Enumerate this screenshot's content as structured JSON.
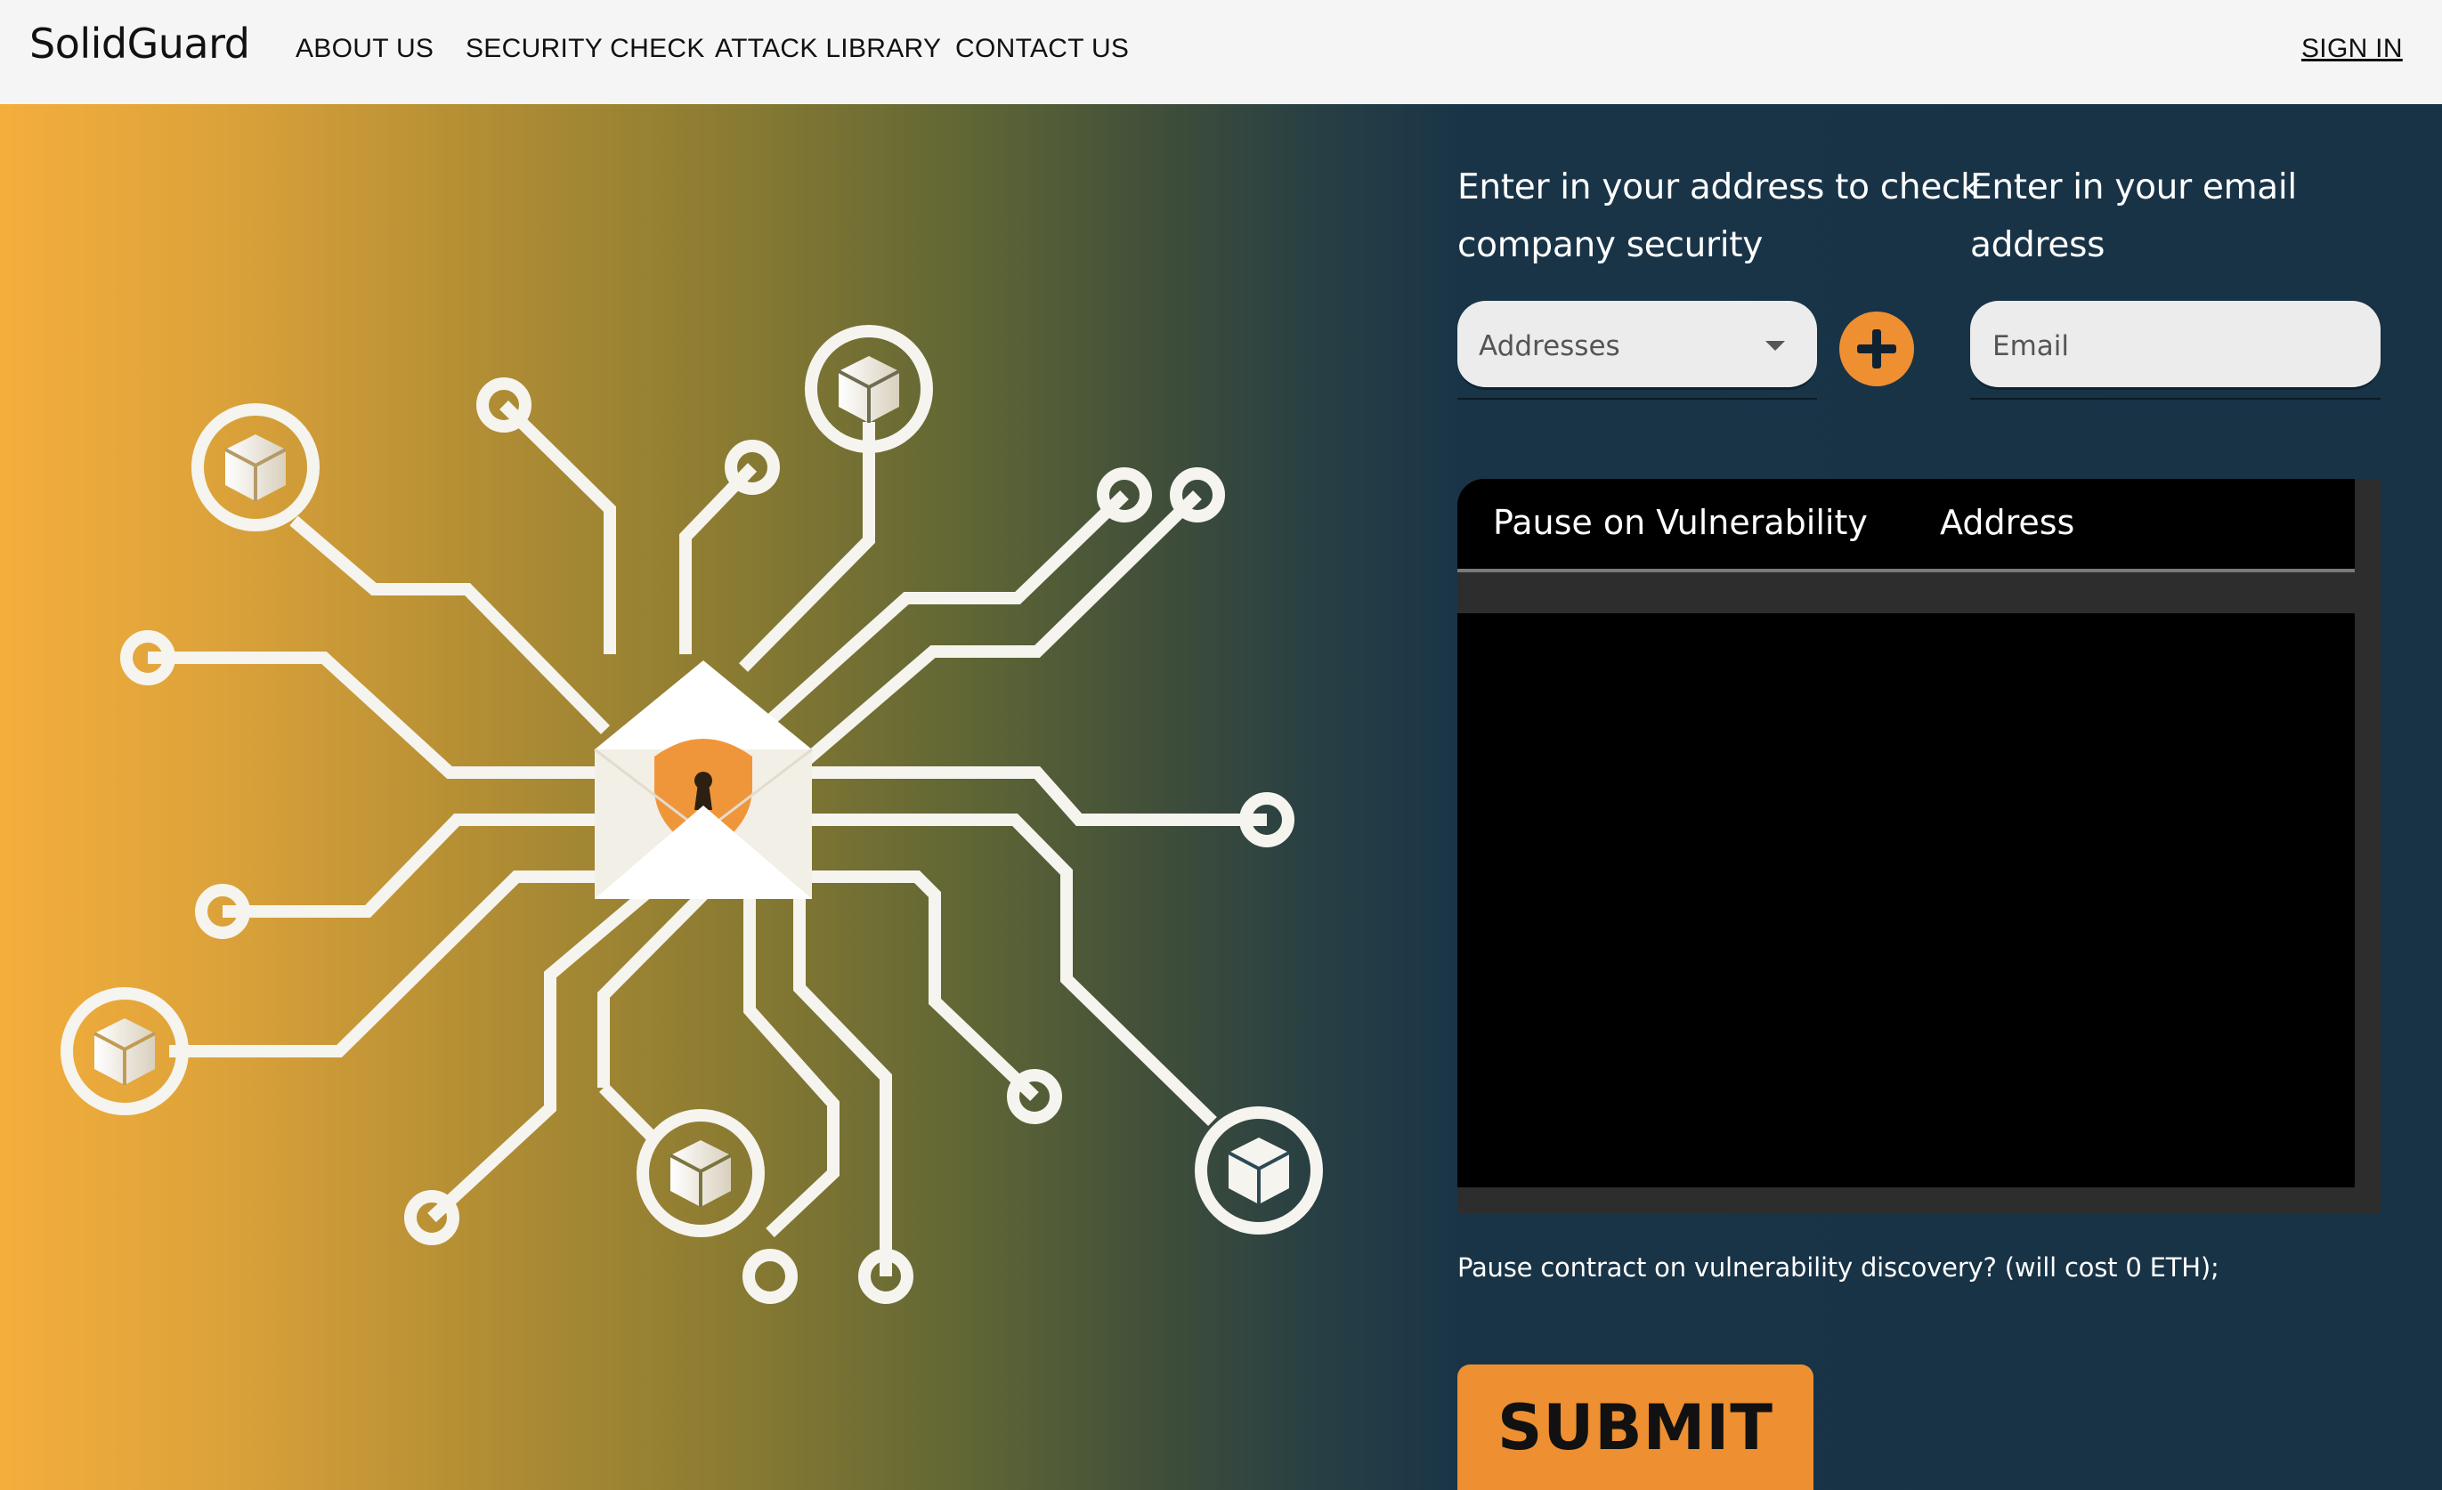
{
  "nav": {
    "brand": "SolidGuard",
    "links": [
      "ABOUT US",
      "SECURITY CHECK",
      "ATTACK LIBRARY",
      "CONTACT US"
    ],
    "signin": "SIGN IN"
  },
  "form": {
    "address_label_line1": "Enter in your address to check",
    "address_label_line2": "company security",
    "email_label": "Enter in your email address",
    "address_placeholder": "Addresses",
    "email_placeholder": "Email"
  },
  "table": {
    "columns": [
      "Pause on Vulnerability",
      "Address"
    ],
    "rows": []
  },
  "note": "Pause contract on vulnerability discovery? (will cost 0 ETH);",
  "submit_label": "SUBMIT",
  "colors": {
    "accent": "#ee8f31",
    "background": "#183246",
    "gradient_start": "#f4ae3c"
  },
  "icons": [
    "shield-lock-envelope-icon",
    "cube-icon",
    "plus-icon",
    "chevron-down-icon"
  ]
}
